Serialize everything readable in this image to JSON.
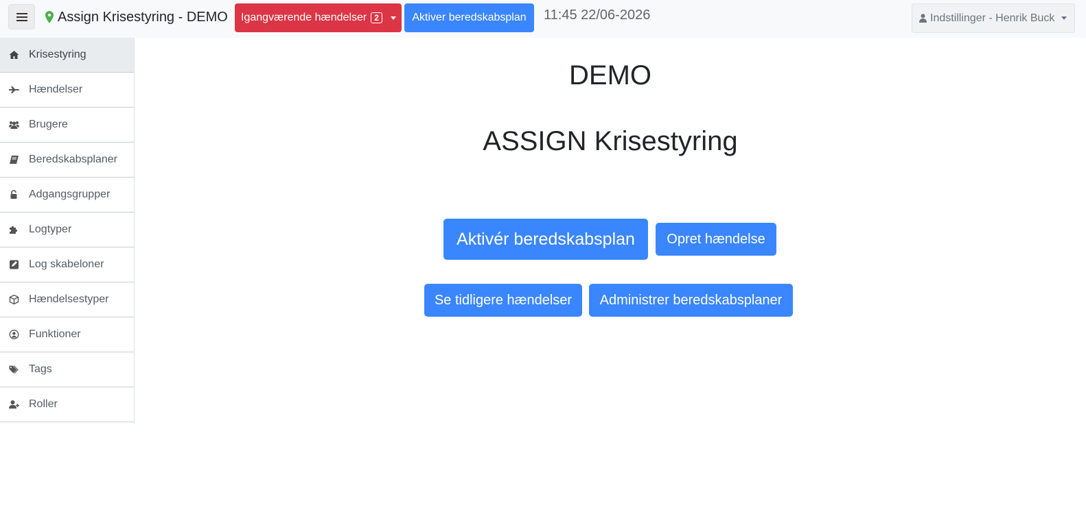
{
  "navbar": {
    "brand": "Assign Krisestyring - DEMO",
    "ongoing_label": "Igangværende hændelser",
    "ongoing_count": "2",
    "activate_label": "Aktiver beredskabsplan",
    "clock": "11:45 22/06-2026",
    "settings_label": "Indstillinger - Henrik Buck",
    "colors": {
      "danger": "#dc3545",
      "primary": "#3a86ff",
      "location_pin": "#4caf50"
    }
  },
  "sidebar": {
    "items": [
      {
        "label": "Krisestyring",
        "icon": "home-icon",
        "active": true
      },
      {
        "label": "Hændelser",
        "icon": "plane-icon"
      },
      {
        "label": "Brugere",
        "icon": "users-icon"
      },
      {
        "label": "Beredskabsplaner",
        "icon": "book-icon"
      },
      {
        "label": "Adgangsgrupper",
        "icon": "unlock-icon"
      },
      {
        "label": "Logtyper",
        "icon": "puzzle-icon"
      },
      {
        "label": "Log skabeloner",
        "icon": "edit-icon"
      },
      {
        "label": "Hændelsestyper",
        "icon": "cube-icon"
      },
      {
        "label": "Funktioner",
        "icon": "user-circle-icon"
      },
      {
        "label": "Tags",
        "icon": "tags-icon"
      },
      {
        "label": "Roller",
        "icon": "user-plus-icon"
      }
    ]
  },
  "main": {
    "title": "DEMO",
    "subtitle": "ASSIGN Krisestyring",
    "activate_plan": "Aktivér beredskabsplan",
    "create_incident": "Opret hændelse",
    "previous_incidents": "Se tidligere hændelser",
    "manage_plans": "Administrer beredskabsplaner"
  }
}
